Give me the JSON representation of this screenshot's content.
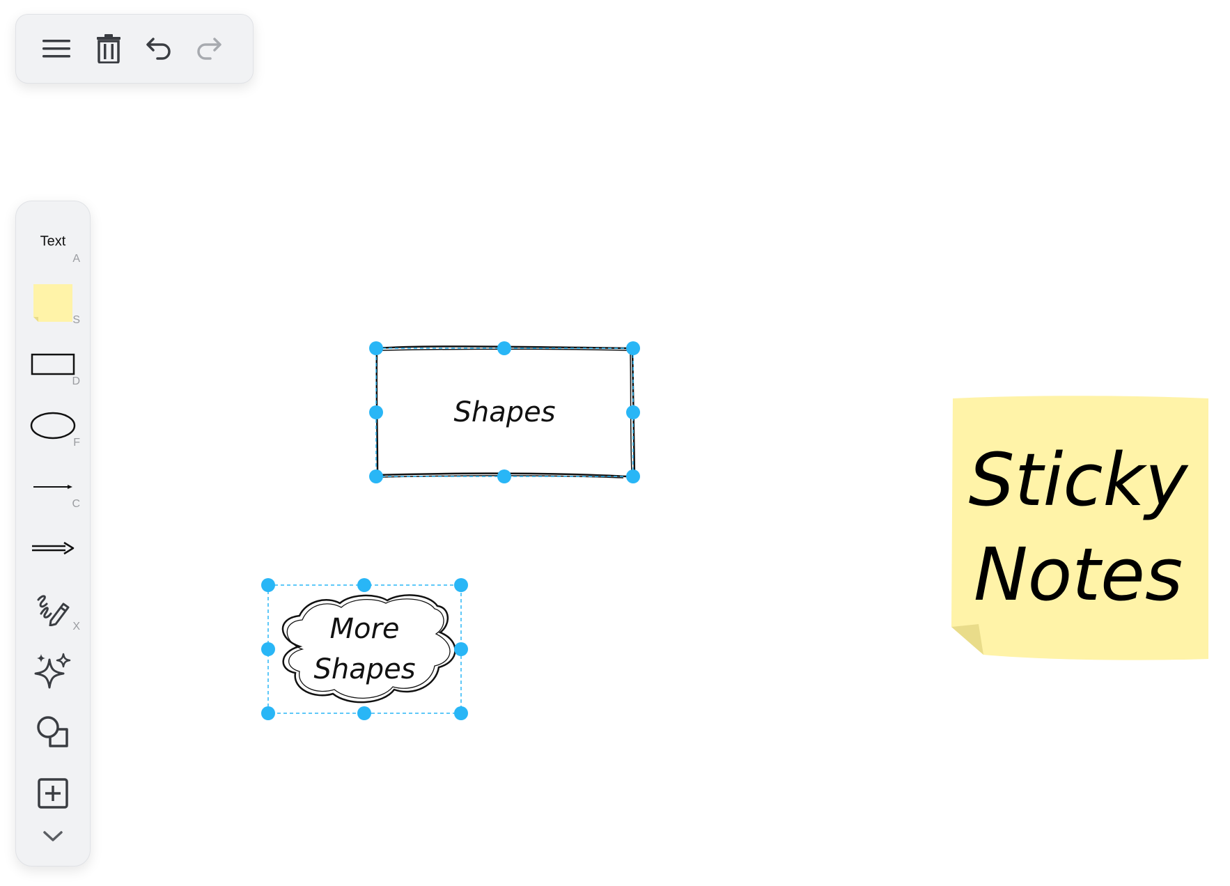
{
  "toolbar": {
    "menu_icon": "hamburger-menu-icon",
    "delete_icon": "trash-icon",
    "undo_icon": "undo-icon",
    "redo_icon": "redo-icon"
  },
  "sidebar": {
    "text_tool": {
      "label": "Text",
      "shortcut": "A"
    },
    "sticky_tool": {
      "icon": "sticky-note-icon",
      "shortcut": "S"
    },
    "rectangle_tool": {
      "icon": "rectangle-icon",
      "shortcut": "D"
    },
    "ellipse_tool": {
      "icon": "ellipse-icon",
      "shortcut": "F"
    },
    "line_tool": {
      "icon": "line-icon",
      "shortcut": "C"
    },
    "arrow_tool": {
      "icon": "arrow-icon",
      "shortcut": ""
    },
    "pen_tool": {
      "icon": "pen-icon",
      "shortcut": "X"
    },
    "ai_tool": {
      "icon": "sparkles-icon"
    },
    "shapes_tool": {
      "icon": "shapes-icon"
    },
    "add_tool": {
      "icon": "plus-square-icon"
    },
    "more_tool": {
      "icon": "chevron-down-icon"
    }
  },
  "canvas": {
    "rectangle_label": "Shapes",
    "cloud_line1": "More",
    "cloud_line2": "Shapes",
    "sticky_line1": "Sticky",
    "sticky_line2": "Notes",
    "colors": {
      "selection": "#29b6f6",
      "sticky_fill": "#fff3a8",
      "toolbar_bg": "#f1f2f4"
    }
  }
}
